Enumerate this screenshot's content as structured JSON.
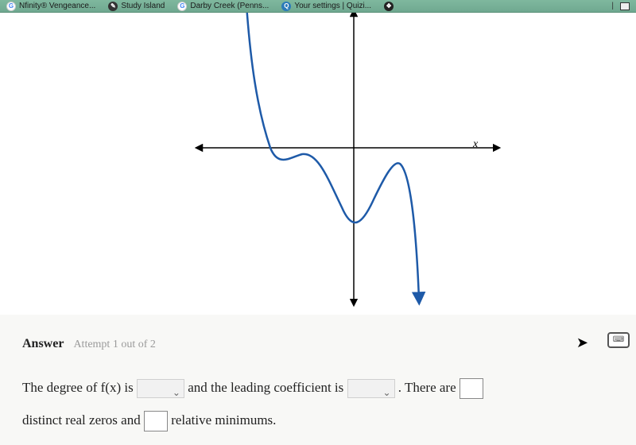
{
  "bookmarks": [
    {
      "icon": "G",
      "label": "Nfinity® Vengeance..."
    },
    {
      "icon": "study",
      "label": "Study Island"
    },
    {
      "icon": "G",
      "label": "Darby Creek (Penns..."
    },
    {
      "icon": "quiz",
      "label": "Your settings | Quizi..."
    },
    {
      "icon": "dark",
      "label": ""
    }
  ],
  "graph": {
    "x_axis_label": "x"
  },
  "answer": {
    "title": "Answer",
    "attempt": "Attempt 1 out of 2",
    "sentence": {
      "part1": "The degree of f(x) is",
      "part2": "and the leading coefficient is",
      "part3": ". There are",
      "part4": "distinct real zeros and",
      "part5": "relative minimums."
    }
  },
  "chart_data": {
    "type": "line",
    "title": "",
    "xlabel": "x",
    "ylabel": "",
    "xlim": [
      -4,
      4
    ],
    "ylim": [
      -4,
      4
    ],
    "description": "Polynomial curve on unlabeled axes. Curve enters from top-left (y → +∞ as x → −∞), crosses x-axis near x ≈ −2, has a small local max just below the x-axis between −2 and 0, dips to a local minimum around x ≈ 0 at roughly y ≈ −2.5, rises to a local max near x ≈ 1 just below the x-axis, then falls toward −∞ as x increases (y → −∞ as x → +∞).",
    "series": [
      {
        "name": "f(x)",
        "x": [
          -3.0,
          -2.4,
          -2.0,
          -1.6,
          -1.2,
          -0.8,
          -0.4,
          0.0,
          0.4,
          0.8,
          1.0,
          1.2,
          1.6
        ],
        "y": [
          4.0,
          2.5,
          0.0,
          -0.3,
          -0.1,
          -0.8,
          -1.8,
          -2.5,
          -2.0,
          -0.7,
          -0.3,
          -0.7,
          -4.0
        ]
      }
    ]
  }
}
